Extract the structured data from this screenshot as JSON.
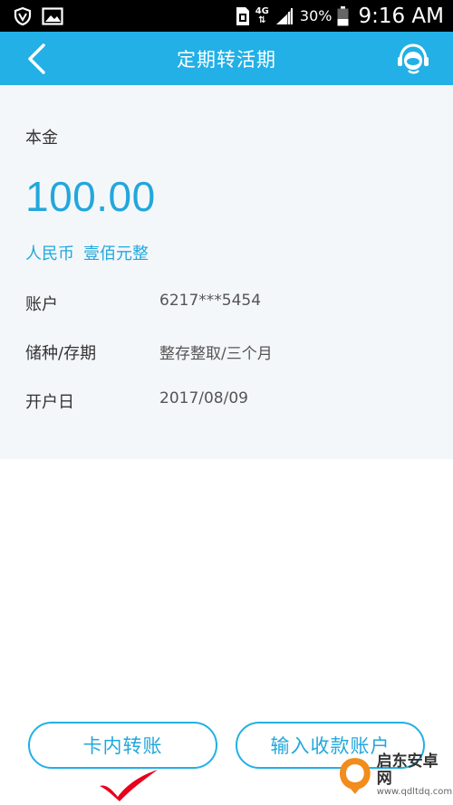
{
  "status_bar": {
    "network": "4G",
    "battery": "30%",
    "time": "9:16 AM"
  },
  "nav": {
    "title": "定期转活期"
  },
  "detail": {
    "principal_label": "本金",
    "amount": "100.00",
    "currency": "人民币",
    "amount_in_words": "壹佰元整",
    "rows": [
      {
        "key": "账户",
        "value": "6217***5454"
      },
      {
        "key": "储种/存期",
        "value": "整存整取/三个月"
      },
      {
        "key": "开户日",
        "value": "2017/08/09"
      }
    ]
  },
  "actions": {
    "internal_transfer": "卡内转账",
    "input_account": "输入收款账户"
  },
  "watermark": {
    "title": "启东安卓网",
    "url": "www.qdltdq.com"
  },
  "colors": {
    "brand_blue": "#22b0e6",
    "amount_blue": "#22a7dc",
    "check_red": "#e8001c"
  }
}
